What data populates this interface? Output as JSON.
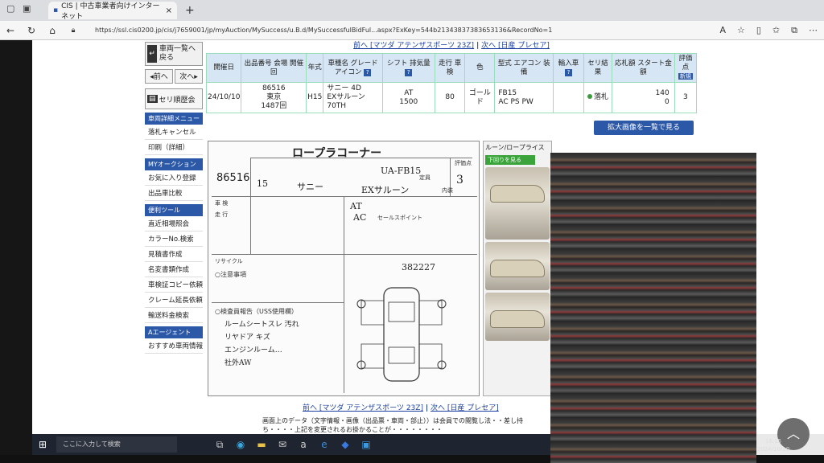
{
  "browser": {
    "tab_title": "CIS | 中古車業者向けインターネット",
    "tab_close": "×",
    "new_tab": "+",
    "url": "https://ssl.cis0200.jp/cis/j7659001/jp/myAuction/MySuccess/u.B.d/MySuccessfulBidFul...aspx?ExKey=544b21343837383653136&RecordNo=1"
  },
  "sidebar": {
    "back_label": "車両一覧へ戻る",
    "prev": "◂前へ",
    "next": "次へ▸",
    "seri_history": "セリ順歴会",
    "menu_vehicle": "車両詳細メニュー",
    "items_vehicle": [
      "落札キャンセル",
      "印刷（詳細）"
    ],
    "menu_my": "MYオークション",
    "items_my": [
      "お気に入り登録",
      "出品車比較"
    ],
    "menu_tools": "便利ツール",
    "items_tools": [
      "直近相場照会",
      "カラーNo.検索",
      "見積書作成",
      "名変書類作成",
      "車検証コピー依頼",
      "クレーム延長依頼",
      "輸送料金検索"
    ],
    "menu_agent": "Aエージェント",
    "items_agent": [
      "おすすめ車両情報"
    ]
  },
  "main": {
    "nav_prev": "前へ [マツダ アテンザスポーツ 23Z]",
    "nav_sep": "|",
    "nav_next": "次へ [日産 プレセア]",
    "headers": [
      "開催日",
      "出品番号 会場 開催回",
      "年式",
      "車種名 グレード",
      "シフト 排気量",
      "走行 車検",
      "色",
      "型式 エアコン 装備",
      "輸入車",
      "セリ結果",
      "応札額 スタート金額",
      "評価点"
    ],
    "row": {
      "date": "24/10/10",
      "lot": "86516",
      "venue": "東京",
      "round": "1487回",
      "year": "H15",
      "model": "サニー 4D",
      "grade": "EXサルーン70TH",
      "shift": "AT",
      "cc": "1500",
      "mileage": "80",
      "color": "ゴールド",
      "type": "FB15",
      "equip": "AC PS PW",
      "result": "落札",
      "bid": "140",
      "start": "0",
      "score": "3"
    },
    "badge_new": "新規",
    "icon_label": "アイコン",
    "big_button": "拡大画像を一覧で見る"
  },
  "sheet": {
    "title": "ロープラコーナー",
    "lot": "86516",
    "hand_type": "UA-FB15",
    "hand_name": "サニー",
    "hand_grade": "EXサルーン",
    "hand_score": "3",
    "hand_year": "15",
    "hand_shift": "AT",
    "hand_ac": "AC",
    "hand_serial": "382227",
    "notes_title": "○注意事項",
    "inspector_title": "○検査員報告（USS使用欄）",
    "inspector_lines": [
      "ルームシートスレ 汚れ",
      "リヤドア キズ",
      "エンジンルーム…",
      "社外AW"
    ],
    "lbl_shaken": "車 検",
    "lbl_run": "走 行",
    "lbl_recycle": "リサイクル",
    "lbl_features": "セールスポイント",
    "lbl_grade_box": "評価点",
    "lbl_interior": "内装",
    "lbl_seats": "定員"
  },
  "photos": {
    "title": "ルーン/ロープライス",
    "button": "下回りを見る"
  },
  "bottom": {
    "nav_prev": "前へ [マツダ アテンザスポーツ 23Z]",
    "nav_next": "次へ [日産 プレセア]",
    "note": "画面上のデータ（文字情報・画像（出品票・車両・部止））は会員での閲覧し法・・差し持ち・・・・上記を変更されるお掛かることが・・・・・・・・"
  },
  "taskbar": {
    "search_placeholder": "ここに入力して検索",
    "time": "16:15",
    "date": "2024/10/10"
  }
}
